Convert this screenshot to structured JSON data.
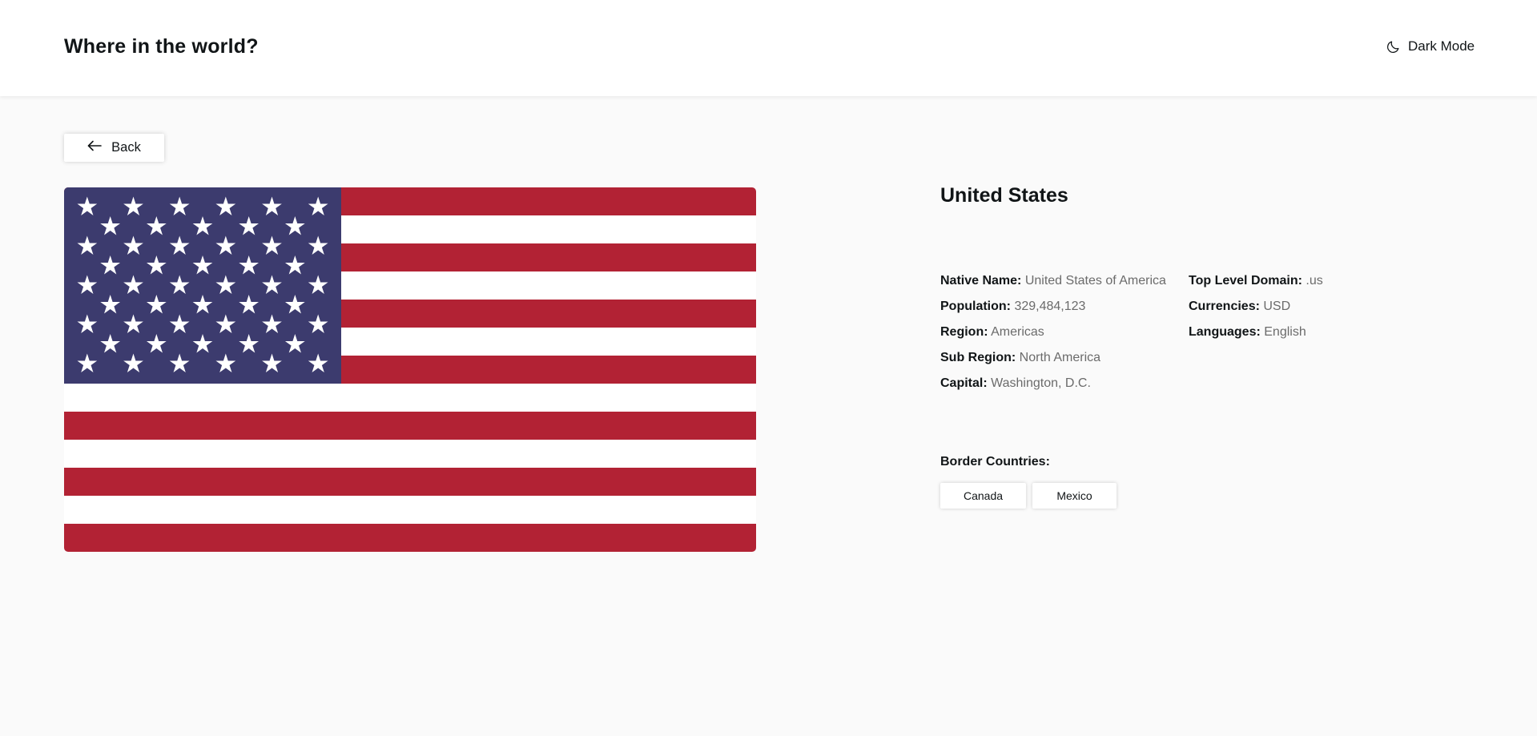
{
  "header": {
    "title": "Where in the world?",
    "theme_toggle_label": "Dark Mode",
    "theme_toggle_icon": "moon-icon"
  },
  "nav": {
    "back_label": "Back",
    "back_icon": "arrow-left-icon"
  },
  "flag": {
    "icon": "us-flag-image",
    "colors": {
      "red": "#B22234",
      "white": "#FFFFFF",
      "blue": "#3C3B6E"
    }
  },
  "country": {
    "name": "United States",
    "left_details": [
      {
        "label": "Native Name:",
        "value": "United States of America"
      },
      {
        "label": "Population:",
        "value": "329,484,123"
      },
      {
        "label": "Region:",
        "value": "Americas"
      },
      {
        "label": "Sub Region:",
        "value": "North America"
      },
      {
        "label": "Capital:",
        "value": "Washington, D.C."
      }
    ],
    "right_details": [
      {
        "label": "Top Level Domain:",
        "value": ".us"
      },
      {
        "label": "Currencies:",
        "value": "USD"
      },
      {
        "label": "Languages:",
        "value": "English"
      }
    ],
    "border_label": "Border Countries:",
    "borders": [
      "Canada",
      "Mexico"
    ]
  }
}
